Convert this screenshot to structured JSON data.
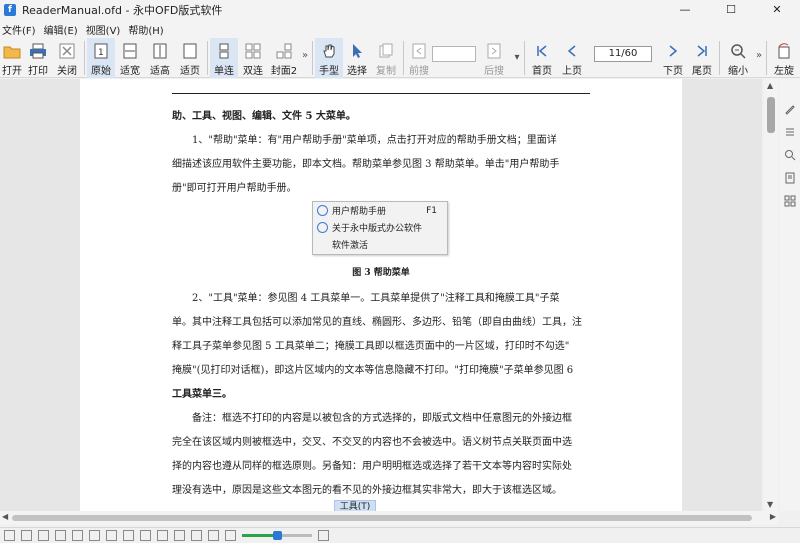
{
  "window": {
    "title": "ReaderManual.ofd - 永中OFD版式软件",
    "app_icon_letter": "f"
  },
  "menubar": [
    "文件(F)",
    "编辑(E)",
    "视图(V)",
    "帮助(H)"
  ],
  "toolbar": {
    "open": "打开",
    "print": "打印",
    "close": "关闭",
    "original": "原始",
    "fit_width": "适宽",
    "fit_height": "适高",
    "fit_page": "适页",
    "single": "单连",
    "double": "双连",
    "cover2": "封面2",
    "hand": "手型",
    "select": "选择",
    "copy": "复制",
    "back": "前搜",
    "forward": "后搜",
    "first_page": "首页",
    "prev_page": "上页",
    "page_value": "11/60",
    "next_page": "下页",
    "last_page": "尾页",
    "zoom_out": "缩小",
    "rotate_left": "左旋"
  },
  "document": {
    "line1": "助、工具、视图、编辑、文件 5 大菜单。",
    "p1_l1": "1、\"帮助\"菜单：有\"用户帮助手册\"菜单项，点击打开对应的帮助手册文档；里面详",
    "p1_l2": "细描述该应用软件主要功能，即本文档。帮助菜单参见图 3 帮助菜单。单击\"用户帮助手",
    "p1_l3": "册\"即可打开用户帮助手册。",
    "figure_menu": {
      "item1": "用户帮助手册",
      "item1_shortcut": "F1",
      "item2": "关于永中版式办公软件",
      "item3": "软件激活"
    },
    "figure3_caption": "图 3  帮助菜单",
    "p2_l1": "2、\"工具\"菜单：参见图 4 工具菜单一。工具菜单提供了\"注释工具和掩膜工具\"子菜",
    "p2_l2": "单。其中注释工具包括可以添加常见的直线、椭圆形、多边形、铅笔（即自由曲线）工具，注",
    "p2_l3": "释工具子菜单参见图 5 工具菜单二；掩膜工具即以框选页面中的一片区域，打印时不勾选\"",
    "p2_l4": "掩膜\"(见打印对话框)，即这片区域内的文本等信息隐藏不打印。\"打印掩膜\"子菜单参见图 6",
    "p2_l5": "工具菜单三。",
    "p3_l1": "备注：框选不打印的内容是以被包含的方式选择的，即版式文档中任意图元的外接边框",
    "p3_l2": "完全在该区域内则被框选中，交叉、不交叉的内容也不会被选中。语义树节点关联页面中选",
    "p3_l3": "择的内容也遵从同样的框选原则。另备知：用户明明框选或选择了若干文本等内容时实际处",
    "p3_l4": "理没有选中，原因是这些文本图元的看不见的外接边框其实非常大，即大于该框选区域。",
    "footer_button": "工具(T)"
  },
  "statusbar": {
    "zoom_fraction": 0.5
  }
}
